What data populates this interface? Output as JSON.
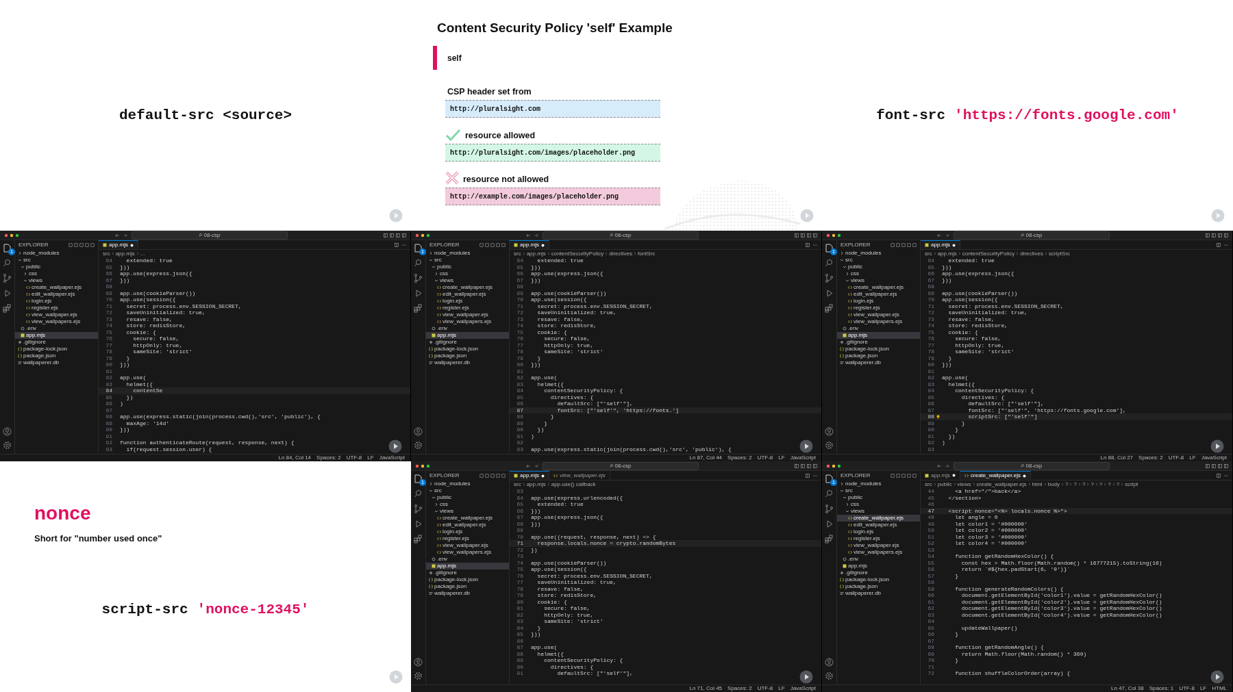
{
  "panels": [
    {
      "kind": "directive",
      "text": "default-src <source>"
    },
    {
      "kind": "csp_example",
      "title": "Content Security Policy 'self' Example",
      "highlight": "self",
      "rows": [
        {
          "kind": "header",
          "label": "CSP header set from",
          "url": "http://pluralsight.com",
          "color": "#d6ecfb"
        },
        {
          "kind": "allowed",
          "label": "resource allowed",
          "url": "http://pluralsight.com/images/placeholder.png",
          "color": "#d3f7e4"
        },
        {
          "kind": "blocked",
          "label": "resource not allowed",
          "url": "http://example.com/images/placeholder.png",
          "color": "#f3cbdc"
        }
      ]
    },
    {
      "kind": "directive",
      "text": "font-src",
      "value": "'https://fonts.google.com'"
    },
    {
      "kind": "editor",
      "search": "08-csp",
      "explorer_title": "EXPLORER",
      "badge": "1",
      "tree": [
        {
          "label": "node_modules",
          "kind": "folder",
          "expanded": false,
          "selected": false
        },
        {
          "label": "src",
          "kind": "folder",
          "expanded": true,
          "selected": false,
          "children": [
            {
              "label": "public",
              "kind": "folder",
              "expanded": true,
              "selected": false,
              "children": [
                {
                  "label": "css",
                  "kind": "folder",
                  "expanded": false,
                  "selected": false
                },
                {
                  "label": "views",
                  "kind": "folder",
                  "expanded": true,
                  "selected": false,
                  "children": [
                    {
                      "label": "create_wallpaper.ejs",
                      "kind": "ejs",
                      "selected": false
                    },
                    {
                      "label": "edit_wallpaper.ejs",
                      "kind": "ejs",
                      "selected": false
                    },
                    {
                      "label": "login.ejs",
                      "kind": "ejs",
                      "selected": false
                    },
                    {
                      "label": "register.ejs",
                      "kind": "ejs",
                      "selected": false
                    },
                    {
                      "label": "view_wallpaper.ejs",
                      "kind": "ejs",
                      "selected": false
                    },
                    {
                      "label": "view_wallpapers.ejs",
                      "kind": "ejs",
                      "selected": false
                    }
                  ]
                }
              ]
            },
            {
              "label": ".env",
              "kind": "env",
              "selected": false
            },
            {
              "label": "app.mjs",
              "kind": "js",
              "selected": true
            }
          ]
        },
        {
          "label": ".gitignore",
          "kind": "git",
          "selected": false
        },
        {
          "label": "package-lock.json",
          "kind": "json",
          "selected": false
        },
        {
          "label": "package.json",
          "kind": "json",
          "selected": false
        },
        {
          "label": "wallpaperer.db",
          "kind": "db",
          "selected": false
        }
      ],
      "tabs": [
        {
          "label": "app.mjs",
          "kind": "js",
          "selected": true,
          "modified": true,
          "preview": false
        }
      ],
      "breadcrumbs": [
        "src",
        "app.mjs",
        "..."
      ],
      "lines": [
        {
          "n": "64",
          "text": "  extended: true",
          "current": false
        },
        {
          "n": "65",
          "text": "}))",
          "current": false
        },
        {
          "n": "66",
          "text": "app.use(express.json({",
          "current": false
        },
        {
          "n": "67",
          "text": "}))",
          "current": false
        },
        {
          "n": "68",
          "current": false
        },
        {
          "n": "69",
          "text": "app.use(cookieParser())",
          "current": false
        },
        {
          "n": "70",
          "text": "app.use(session({",
          "current": false
        },
        {
          "n": "71",
          "text": "  secret: process.env.SESSION_SECRET,",
          "current": false
        },
        {
          "n": "72",
          "text": "  saveUninitialized: true,",
          "current": false
        },
        {
          "n": "73",
          "text": "  resave: false,",
          "current": false
        },
        {
          "n": "74",
          "text": "  store: redisStore,",
          "current": false
        },
        {
          "n": "75",
          "text": "  cookie: {",
          "current": false
        },
        {
          "n": "76",
          "text": "    secure: false,",
          "current": false
        },
        {
          "n": "77",
          "text": "    httpOnly: true,",
          "current": false
        },
        {
          "n": "78",
          "text": "    sameSite: 'strict'",
          "current": false
        },
        {
          "n": "79",
          "text": "  }",
          "current": false
        },
        {
          "n": "80",
          "text": "}))",
          "current": false
        },
        {
          "n": "81",
          "current": false
        },
        {
          "n": "82",
          "text": "app.use(",
          "current": false
        },
        {
          "n": "83",
          "text": "  helmet({",
          "current": false
        },
        {
          "n": "84",
          "text": "    contentSe",
          "current": true
        },
        {
          "n": "85",
          "text": "  })",
          "current": false
        },
        {
          "n": "86",
          "text": ")",
          "current": false
        },
        {
          "n": "87",
          "current": false
        },
        {
          "n": "88",
          "text": "app.use(express.static(join(process.cwd(),'src', 'public'), {",
          "current": false
        },
        {
          "n": "89",
          "text": "  maxAge: '14d'",
          "current": false
        },
        {
          "n": "90",
          "text": "}))",
          "current": false
        },
        {
          "n": "91",
          "current": false
        },
        {
          "n": "92",
          "text": "function authenticateRoute(request, response, next) {",
          "current": false
        },
        {
          "n": "93",
          "text": "  if(request.session.user) {",
          "current": false
        }
      ],
      "status": [
        "Ln 84, Col 14",
        "Spaces: 2",
        "UTF-8",
        "LF",
        "JavaScript"
      ]
    },
    {
      "kind": "editor",
      "search": "08-csp",
      "explorer_title": "EXPLORER",
      "badge": "1",
      "tree": [
        {
          "label": "node_modules",
          "kind": "folder",
          "expanded": false,
          "selected": false
        },
        {
          "label": "src",
          "kind": "folder",
          "expanded": true,
          "selected": false,
          "children": [
            {
              "label": "public",
              "kind": "folder",
              "expanded": true,
              "selected": false,
              "children": [
                {
                  "label": "css",
                  "kind": "folder",
                  "expanded": false,
                  "selected": false
                },
                {
                  "label": "views",
                  "kind": "folder",
                  "expanded": true,
                  "selected": false,
                  "children": [
                    {
                      "label": "create_wallpaper.ejs",
                      "kind": "ejs",
                      "selected": false
                    },
                    {
                      "label": "edit_wallpaper.ejs",
                      "kind": "ejs",
                      "selected": false
                    },
                    {
                      "label": "login.ejs",
                      "kind": "ejs",
                      "selected": false
                    },
                    {
                      "label": "register.ejs",
                      "kind": "ejs",
                      "selected": false
                    },
                    {
                      "label": "view_wallpaper.ejs",
                      "kind": "ejs",
                      "selected": false
                    },
                    {
                      "label": "view_wallpapers.ejs",
                      "kind": "ejs",
                      "selected": false
                    }
                  ]
                }
              ]
            },
            {
              "label": ".env",
              "kind": "env",
              "selected": false
            },
            {
              "label": "app.mjs",
              "kind": "js",
              "selected": true
            }
          ]
        },
        {
          "label": ".gitignore",
          "kind": "git",
          "selected": false
        },
        {
          "label": "package-lock.json",
          "kind": "json",
          "selected": false
        },
        {
          "label": "package.json",
          "kind": "json",
          "selected": false
        },
        {
          "label": "wallpaperer.db",
          "kind": "db",
          "selected": false
        }
      ],
      "tabs": [
        {
          "label": "app.mjs",
          "kind": "js",
          "selected": true,
          "modified": true,
          "preview": false
        }
      ],
      "breadcrumbs": [
        "src",
        "app.mjs",
        "contentSecurityPolicy",
        "directives",
        "fontSrc"
      ],
      "lines": [
        {
          "n": "64",
          "text": "  extended: true",
          "current": false
        },
        {
          "n": "65",
          "text": "}))",
          "current": false
        },
        {
          "n": "66",
          "text": "app.use(express.json({",
          "current": false
        },
        {
          "n": "67",
          "text": "}))",
          "current": false
        },
        {
          "n": "68",
          "current": false
        },
        {
          "n": "69",
          "text": "app.use(cookieParser())",
          "current": false
        },
        {
          "n": "70",
          "text": "app.use(session({",
          "current": false
        },
        {
          "n": "71",
          "text": "  secret: process.env.SESSION_SECRET,",
          "current": false
        },
        {
          "n": "72",
          "text": "  saveUninitialized: true,",
          "current": false
        },
        {
          "n": "73",
          "text": "  resave: false,",
          "current": false
        },
        {
          "n": "74",
          "text": "  store: redisStore,",
          "current": false
        },
        {
          "n": "75",
          "text": "  cookie: {",
          "current": false
        },
        {
          "n": "76",
          "text": "    secure: false,",
          "current": false
        },
        {
          "n": "77",
          "text": "    httpOnly: true,",
          "current": false
        },
        {
          "n": "78",
          "text": "    sameSite: 'strict'",
          "current": false
        },
        {
          "n": "79",
          "text": "  }",
          "current": false
        },
        {
          "n": "80",
          "text": "}))",
          "current": false
        },
        {
          "n": "81",
          "current": false
        },
        {
          "n": "82",
          "text": "app.use(",
          "current": false
        },
        {
          "n": "83",
          "text": "  helmet({",
          "current": false
        },
        {
          "n": "84",
          "text": "    contentSecurityPolicy: {",
          "current": false
        },
        {
          "n": "85",
          "text": "      directives: {",
          "current": false
        },
        {
          "n": "86",
          "text": "        defaultSrc: [\"'self'\"],",
          "current": false
        },
        {
          "n": "87",
          "text": "        fontSrc: [\"'self'\", 'https://fonts.']",
          "current": true
        },
        {
          "n": "88",
          "text": "      }",
          "current": false
        },
        {
          "n": "89",
          "text": "    }",
          "current": false
        },
        {
          "n": "90",
          "text": "  })",
          "current": false
        },
        {
          "n": "91",
          "text": ")",
          "current": false
        },
        {
          "n": "92",
          "current": false
        },
        {
          "n": "93",
          "text": "app.use(express.static(join(process.cwd(),'src', 'public'), {",
          "current": false
        }
      ],
      "status": [
        "Ln 87, Col 44",
        "Spaces: 2",
        "UTF-8",
        "LF",
        "JavaScript"
      ]
    },
    {
      "kind": "editor",
      "search": "08-csp",
      "explorer_title": "EXPLORER",
      "badge": "1",
      "tree": [
        {
          "label": "node_modules",
          "kind": "folder",
          "expanded": false,
          "selected": false
        },
        {
          "label": "src",
          "kind": "folder",
          "expanded": true,
          "selected": false,
          "children": [
            {
              "label": "public",
              "kind": "folder",
              "expanded": true,
              "selected": false,
              "children": [
                {
                  "label": "css",
                  "kind": "folder",
                  "expanded": false,
                  "selected": false
                },
                {
                  "label": "views",
                  "kind": "folder",
                  "expanded": true,
                  "selected": false,
                  "children": [
                    {
                      "label": "create_wallpaper.ejs",
                      "kind": "ejs",
                      "selected": false
                    },
                    {
                      "label": "edit_wallpaper.ejs",
                      "kind": "ejs",
                      "selected": false
                    },
                    {
                      "label": "login.ejs",
                      "kind": "ejs",
                      "selected": false
                    },
                    {
                      "label": "register.ejs",
                      "kind": "ejs",
                      "selected": false
                    },
                    {
                      "label": "view_wallpaper.ejs",
                      "kind": "ejs",
                      "selected": false
                    },
                    {
                      "label": "view_wallpapers.ejs",
                      "kind": "ejs",
                      "selected": false
                    }
                  ]
                }
              ]
            },
            {
              "label": ".env",
              "kind": "env",
              "selected": false
            },
            {
              "label": "app.mjs",
              "kind": "js",
              "selected": true
            }
          ]
        },
        {
          "label": ".gitignore",
          "kind": "git",
          "selected": false
        },
        {
          "label": "package-lock.json",
          "kind": "json",
          "selected": false
        },
        {
          "label": "package.json",
          "kind": "json",
          "selected": false
        },
        {
          "label": "wallpaperer.db",
          "kind": "db",
          "selected": false
        }
      ],
      "tabs": [
        {
          "label": "app.mjs",
          "kind": "js",
          "selected": true,
          "modified": true,
          "preview": false
        }
      ],
      "breadcrumbs": [
        "src",
        "app.mjs",
        "contentSecurityPolicy",
        "directives",
        "scriptSrc"
      ],
      "lines": [
        {
          "n": "64",
          "text": "  extended: true",
          "current": false
        },
        {
          "n": "65",
          "text": "}))",
          "current": false
        },
        {
          "n": "66",
          "text": "app.use(express.json({",
          "current": false
        },
        {
          "n": "67",
          "text": "}))",
          "current": false
        },
        {
          "n": "68",
          "current": false
        },
        {
          "n": "69",
          "text": "app.use(cookieParser())",
          "current": false
        },
        {
          "n": "70",
          "text": "app.use(session({",
          "current": false
        },
        {
          "n": "71",
          "text": "  secret: process.env.SESSION_SECRET,",
          "current": false
        },
        {
          "n": "72",
          "text": "  saveUninitialized: true,",
          "current": false
        },
        {
          "n": "73",
          "text": "  resave: false,",
          "current": false
        },
        {
          "n": "74",
          "text": "  store: redisStore,",
          "current": false
        },
        {
          "n": "75",
          "text": "  cookie: {",
          "current": false
        },
        {
          "n": "76",
          "text": "    secure: false,",
          "current": false
        },
        {
          "n": "77",
          "text": "    httpOnly: true,",
          "current": false
        },
        {
          "n": "78",
          "text": "    sameSite: 'strict'",
          "current": false
        },
        {
          "n": "79",
          "text": "  }",
          "current": false
        },
        {
          "n": "80",
          "text": "}))",
          "current": false
        },
        {
          "n": "81",
          "current": false
        },
        {
          "n": "82",
          "text": "app.use(",
          "current": false
        },
        {
          "n": "83",
          "text": "  helmet({",
          "current": false
        },
        {
          "n": "84",
          "text": "    contentSecurityPolicy: {",
          "current": false
        },
        {
          "n": "85",
          "text": "      directives: {",
          "current": false
        },
        {
          "n": "86",
          "text": "        defaultSrc: [\"'self'\"],",
          "current": false
        },
        {
          "n": "87",
          "text": "        fontSrc: [\"'self'\", 'https://fonts.google.com'],",
          "current": false
        },
        {
          "n": "88",
          "text": "        scriptSrc: [\"'self'\"]",
          "current": true,
          "hint": true
        },
        {
          "n": "89",
          "text": "      }",
          "current": false
        },
        {
          "n": "90",
          "text": "    }",
          "current": false
        },
        {
          "n": "91",
          "text": "  })",
          "current": false
        },
        {
          "n": "92",
          "text": ")",
          "current": false
        },
        {
          "n": "93",
          "current": false
        }
      ],
      "status": [
        "Ln 88, Col 27",
        "Spaces: 2",
        "UTF-8",
        "LF",
        "JavaScript"
      ]
    },
    {
      "kind": "nonce_intro",
      "heading": "nonce",
      "subtitle": "Short for \"number used once\"",
      "text": "script-src",
      "value": "'nonce-12345'"
    },
    {
      "kind": "editor",
      "search": "08-csp",
      "explorer_title": "EXPLORER",
      "badge": "1",
      "tree": [
        {
          "label": "node_modules",
          "kind": "folder",
          "expanded": false,
          "selected": false
        },
        {
          "label": "src",
          "kind": "folder",
          "expanded": true,
          "selected": false,
          "children": [
            {
              "label": "public",
              "kind": "folder",
              "expanded": true,
              "selected": false,
              "children": [
                {
                  "label": "css",
                  "kind": "folder",
                  "expanded": false,
                  "selected": false
                },
                {
                  "label": "views",
                  "kind": "folder",
                  "expanded": true,
                  "selected": false,
                  "children": [
                    {
                      "label": "create_wallpaper.ejs",
                      "kind": "ejs",
                      "selected": false
                    },
                    {
                      "label": "edit_wallpaper.ejs",
                      "kind": "ejs",
                      "selected": false
                    },
                    {
                      "label": "login.ejs",
                      "kind": "ejs",
                      "selected": false
                    },
                    {
                      "label": "register.ejs",
                      "kind": "ejs",
                      "selected": false
                    },
                    {
                      "label": "view_wallpaper.ejs",
                      "kind": "ejs",
                      "selected": false
                    },
                    {
                      "label": "view_wallpapers.ejs",
                      "kind": "ejs",
                      "selected": false
                    }
                  ]
                }
              ]
            },
            {
              "label": ".env",
              "kind": "env",
              "selected": false
            },
            {
              "label": "app.mjs",
              "kind": "js",
              "selected": true
            }
          ]
        },
        {
          "label": ".gitignore",
          "kind": "git",
          "selected": false
        },
        {
          "label": "package-lock.json",
          "kind": "json",
          "selected": false
        },
        {
          "label": "package.json",
          "kind": "json",
          "selected": false
        },
        {
          "label": "wallpaperer.db",
          "kind": "db",
          "selected": false
        }
      ],
      "tabs": [
        {
          "label": "app.mjs",
          "kind": "js",
          "selected": true,
          "modified": true,
          "preview": false
        },
        {
          "label": "view_wallpaper.ejs",
          "kind": "ejs",
          "selected": false,
          "modified": false,
          "preview": true
        }
      ],
      "breadcrumbs": [
        "src",
        "app.mjs",
        "app.use() callback"
      ],
      "lines": [
        {
          "n": "63",
          "current": false
        },
        {
          "n": "64",
          "text": "app.use(express.urlencoded({",
          "current": false
        },
        {
          "n": "65",
          "text": "  extended: true",
          "current": false
        },
        {
          "n": "66",
          "text": "}))",
          "current": false
        },
        {
          "n": "67",
          "text": "app.use(express.json({",
          "current": false
        },
        {
          "n": "68",
          "text": "}))",
          "current": false
        },
        {
          "n": "69",
          "current": false
        },
        {
          "n": "70",
          "text": "app.use((request, response, next) => {",
          "current": false
        },
        {
          "n": "71",
          "text": "  response.locals.nonce = crypto.randomBytes",
          "current": true
        },
        {
          "n": "72",
          "text": "})",
          "current": false
        },
        {
          "n": "73",
          "current": false
        },
        {
          "n": "74",
          "text": "app.use(cookieParser())",
          "current": false
        },
        {
          "n": "75",
          "text": "app.use(session({",
          "current": false
        },
        {
          "n": "76",
          "text": "  secret: process.env.SESSION_SECRET,",
          "current": false
        },
        {
          "n": "77",
          "text": "  saveUninitialized: true,",
          "current": false
        },
        {
          "n": "78",
          "text": "  resave: false,",
          "current": false
        },
        {
          "n": "79",
          "text": "  store: redisStore,",
          "current": false
        },
        {
          "n": "80",
          "text": "  cookie: {",
          "current": false
        },
        {
          "n": "81",
          "text": "    secure: false,",
          "current": false
        },
        {
          "n": "82",
          "text": "    httpOnly: true,",
          "current": false
        },
        {
          "n": "83",
          "text": "    sameSite: 'strict'",
          "current": false
        },
        {
          "n": "84",
          "text": "  }",
          "current": false
        },
        {
          "n": "85",
          "text": "}))",
          "current": false
        },
        {
          "n": "86",
          "current": false
        },
        {
          "n": "87",
          "text": "app.use(",
          "current": false
        },
        {
          "n": "88",
          "text": "  helmet({",
          "current": false
        },
        {
          "n": "89",
          "text": "    contentSecurityPolicy: {",
          "current": false
        },
        {
          "n": "90",
          "text": "      directives: {",
          "current": false
        },
        {
          "n": "91",
          "text": "        defaultSrc: [\"'self'\"],",
          "current": false
        }
      ],
      "status": [
        "Ln 71, Col 45",
        "Spaces: 2",
        "UTF-8",
        "LF",
        "JavaScript"
      ]
    },
    {
      "kind": "editor",
      "search": "08-csp",
      "explorer_title": "EXPLORER",
      "badge": "1",
      "tree": [
        {
          "label": "node_modules",
          "kind": "folder",
          "expanded": false,
          "selected": false
        },
        {
          "label": "src",
          "kind": "folder",
          "expanded": true,
          "selected": false,
          "children": [
            {
              "label": "public",
              "kind": "folder",
              "expanded": true,
              "selected": false,
              "children": [
                {
                  "label": "css",
                  "kind": "folder",
                  "expanded": false,
                  "selected": false
                },
                {
                  "label": "views",
                  "kind": "folder",
                  "expanded": true,
                  "selected": false,
                  "children": [
                    {
                      "label": "create_wallpaper.ejs",
                      "kind": "ejs",
                      "selected": true
                    },
                    {
                      "label": "edit_wallpaper.ejs",
                      "kind": "ejs",
                      "selected": false
                    },
                    {
                      "label": "login.ejs",
                      "kind": "ejs",
                      "selected": false
                    },
                    {
                      "label": "register.ejs",
                      "kind": "ejs",
                      "selected": false
                    },
                    {
                      "label": "view_wallpaper.ejs",
                      "kind": "ejs",
                      "selected": false
                    },
                    {
                      "label": "view_wallpapers.ejs",
                      "kind": "ejs",
                      "selected": false
                    }
                  ]
                }
              ]
            },
            {
              "label": ".env",
              "kind": "env",
              "selected": false
            },
            {
              "label": "app.mjs",
              "kind": "js",
              "selected": false
            }
          ]
        },
        {
          "label": ".gitignore",
          "kind": "git",
          "selected": false
        },
        {
          "label": "package-lock.json",
          "kind": "json",
          "selected": false
        },
        {
          "label": "package.json",
          "kind": "json",
          "selected": false
        },
        {
          "label": "wallpaperer.db",
          "kind": "db",
          "selected": false
        }
      ],
      "tabs": [
        {
          "label": "app.mjs",
          "kind": "js",
          "selected": false,
          "modified": true,
          "preview": false
        },
        {
          "label": "create_wallpaper.ejs",
          "kind": "ejs",
          "selected": true,
          "modified": true,
          "preview": false
        }
      ],
      "breadcrumbs": [
        "src",
        "public",
        "views",
        "create_wallpaper.ejs",
        "html",
        "body",
        "?",
        "?",
        "?",
        "?",
        "?",
        "?",
        "?",
        "script"
      ],
      "lines": [
        {
          "n": "44",
          "text": "    <a href=\"/\">back</a>",
          "current": false
        },
        {
          "n": "45",
          "text": "  </section>",
          "current": false
        },
        {
          "n": "46",
          "current": false
        },
        {
          "n": "47",
          "text": "  <script nonce=\"<%= locals.nonce %>\">",
          "current": true
        },
        {
          "n": "48",
          "text": "    let angle = 0",
          "current": false
        },
        {
          "n": "49",
          "text": "    let color1 = '#000000'",
          "current": false
        },
        {
          "n": "50",
          "text": "    let color2 = '#000000'",
          "current": false
        },
        {
          "n": "51",
          "text": "    let color3 = '#000000'",
          "current": false
        },
        {
          "n": "52",
          "text": "    let color4 = '#000000'",
          "current": false
        },
        {
          "n": "53",
          "current": false
        },
        {
          "n": "54",
          "text": "    function getRandomHexColor() {",
          "current": false
        },
        {
          "n": "55",
          "text": "      const hex = Math.floor(Math.random() * 16777215).toString(16)",
          "current": false
        },
        {
          "n": "56",
          "text": "      return `#${hex.padStart(6, '0')}`",
          "current": false
        },
        {
          "n": "57",
          "text": "    }",
          "current": false
        },
        {
          "n": "58",
          "current": false
        },
        {
          "n": "59",
          "text": "    function generateRandomColors() {",
          "current": false
        },
        {
          "n": "60",
          "text": "      document.getElementById('color1').value = getRandomHexColor()",
          "current": false
        },
        {
          "n": "61",
          "text": "      document.getElementById('color2').value = getRandomHexColor()",
          "current": false
        },
        {
          "n": "62",
          "text": "      document.getElementById('color3').value = getRandomHexColor()",
          "current": false
        },
        {
          "n": "63",
          "text": "      document.getElementById('color4').value = getRandomHexColor()",
          "current": false
        },
        {
          "n": "64",
          "current": false
        },
        {
          "n": "65",
          "text": "      updateWallpaper()",
          "current": false
        },
        {
          "n": "66",
          "text": "    }",
          "current": false
        },
        {
          "n": "67",
          "current": false
        },
        {
          "n": "68",
          "text": "    function getRandomAngle() {",
          "current": false
        },
        {
          "n": "69",
          "text": "      return Math.floor(Math.random() * 360)",
          "current": false
        },
        {
          "n": "70",
          "text": "    }",
          "current": false
        },
        {
          "n": "71",
          "current": false
        },
        {
          "n": "72",
          "text": "    function shuffleColorOrder(array) {",
          "current": false
        }
      ],
      "status": [
        "Ln 47, Col 38",
        "Spaces: 1",
        "UTF-8",
        "LF",
        "HTML"
      ]
    }
  ]
}
